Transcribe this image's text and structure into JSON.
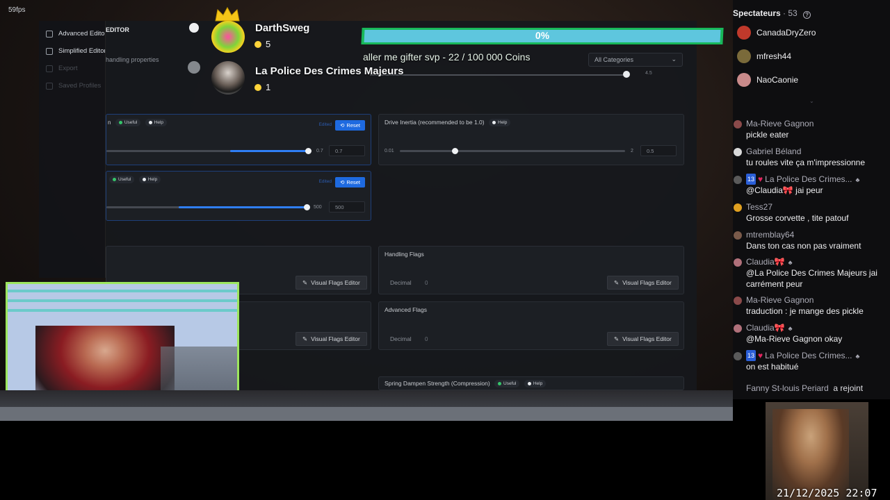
{
  "stream": {
    "fps": "59fps"
  },
  "game_menu": {
    "side_items": [
      "Advanced Editor",
      "Simplified Editor",
      "Export",
      "Saved Profiles"
    ],
    "title": "EDITOR",
    "handling_properties": "handling properties",
    "category_select": "All Categories",
    "top_value": "4.5",
    "cards": {
      "card1": {
        "tag_useful": "Useful",
        "tag_help": "Help",
        "edited": "Edited",
        "reset": "Reset",
        "slider_max": "0.7",
        "value": "0.7",
        "fill": 0.97
      },
      "card2": {
        "title": "Drive Inertia (recommended to be 1.0)",
        "tag_help": "Help",
        "slider_min": "0.01",
        "slider_max": "2",
        "value": "0.5",
        "fill": 0.25
      },
      "card3": {
        "tag_useful": "Useful",
        "tag_help": "Help",
        "edited": "Edited",
        "reset": "Reset",
        "slider_max": "500",
        "value": "500",
        "fill": 1.0
      },
      "handling_flags": {
        "title": "Handling Flags",
        "decimal_label": "Decimal",
        "decimal_value": "0",
        "button": "Visual Flags Editor"
      },
      "left_flags": {
        "button": "Visual Flags Editor"
      },
      "advanced_flags": {
        "title": "Advanced Flags",
        "decimal_label": "Decimal",
        "decimal_value": "0",
        "button": "Visual Flags Editor"
      },
      "left_flags2": {
        "button": "Visual Flags Editor"
      },
      "spring": {
        "title": "Spring Dampen Strength (Compression)",
        "tag_useful": "Useful",
        "tag_help": "Help"
      }
    }
  },
  "overlay": {
    "top_user": {
      "name": "DarthSweg",
      "count": "5"
    },
    "second_user": {
      "name": "La Police Des Crimes Majeurs",
      "count": "1"
    },
    "goal": {
      "percent_label": "0%",
      "fraction": 0.0,
      "text": "aller me gifter svp - 22 / 100 000 Coins"
    }
  },
  "chat": {
    "viewers_label": "Spectateurs",
    "viewers_count": "· 53",
    "viewers": [
      {
        "name": "CanadaDryZero",
        "color": "#c0392b"
      },
      {
        "name": "mfresh44",
        "color": "#7a6a3a"
      },
      {
        "name": "NaoCaonie",
        "color": "#c98a8a"
      }
    ],
    "messages": [
      {
        "user": "Ma-Rieve Gagnon",
        "text": "pickle eater"
      },
      {
        "user": "Gabriel Béland",
        "text": "tu roules vite ça m'impressionne"
      },
      {
        "user": "La Police Des Crimes...",
        "badge": "13",
        "text": "@Claudia🎀 jai peur"
      },
      {
        "user": "Tess27",
        "text": "Grosse corvette , tite patouf"
      },
      {
        "user": "mtremblay64",
        "text": "Dans ton cas non pas vraiment"
      },
      {
        "user": "Claudia🎀",
        "text": "@La Police Des Crimes Majeurs jai carrément peur"
      },
      {
        "user": "Ma-Rieve Gagnon",
        "text": "traduction : je mange des pickle"
      },
      {
        "user": "Claudia🎀",
        "text": "@Ma-Rieve Gagnon okay"
      },
      {
        "user": "La Police Des Crimes...",
        "badge": "13",
        "text": "on est habitué"
      }
    ],
    "joined_user": "Fanny St-louis Periard",
    "joined_text": "a rejoint"
  },
  "cam2": {
    "timestamp": "21/12/2025 22:07"
  }
}
